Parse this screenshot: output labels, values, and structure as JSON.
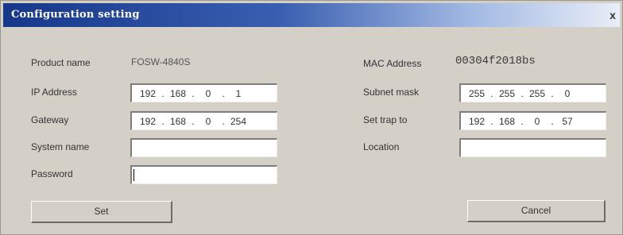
{
  "window": {
    "title": "Configuration setting",
    "close_glyph": "x"
  },
  "left": {
    "product_name": {
      "label": "Product name",
      "value": "FOSW-4840S"
    },
    "ip_address": {
      "label": "IP Address",
      "octets": [
        "192",
        "168",
        "0",
        "1"
      ]
    },
    "gateway": {
      "label": "Gateway",
      "octets": [
        "192",
        "168",
        "0",
        "254"
      ]
    },
    "system_name": {
      "label": "System name",
      "value": ""
    },
    "password": {
      "label": "Password",
      "value": ""
    }
  },
  "right": {
    "mac_address": {
      "label": "MAC Address",
      "value": "00304f2018bs"
    },
    "subnet_mask": {
      "label": "Subnet mask",
      "octets": [
        "255",
        "255",
        "255",
        "0"
      ]
    },
    "set_trap_to": {
      "label": "Set trap to",
      "octets": [
        "192",
        "168",
        "0",
        "57"
      ]
    },
    "location": {
      "label": "Location",
      "value": ""
    }
  },
  "buttons": {
    "set": "Set",
    "cancel": "Cancel"
  },
  "colors": {
    "title_gradient_start": "#16378a",
    "dialog_background": "#d4d0c8"
  }
}
